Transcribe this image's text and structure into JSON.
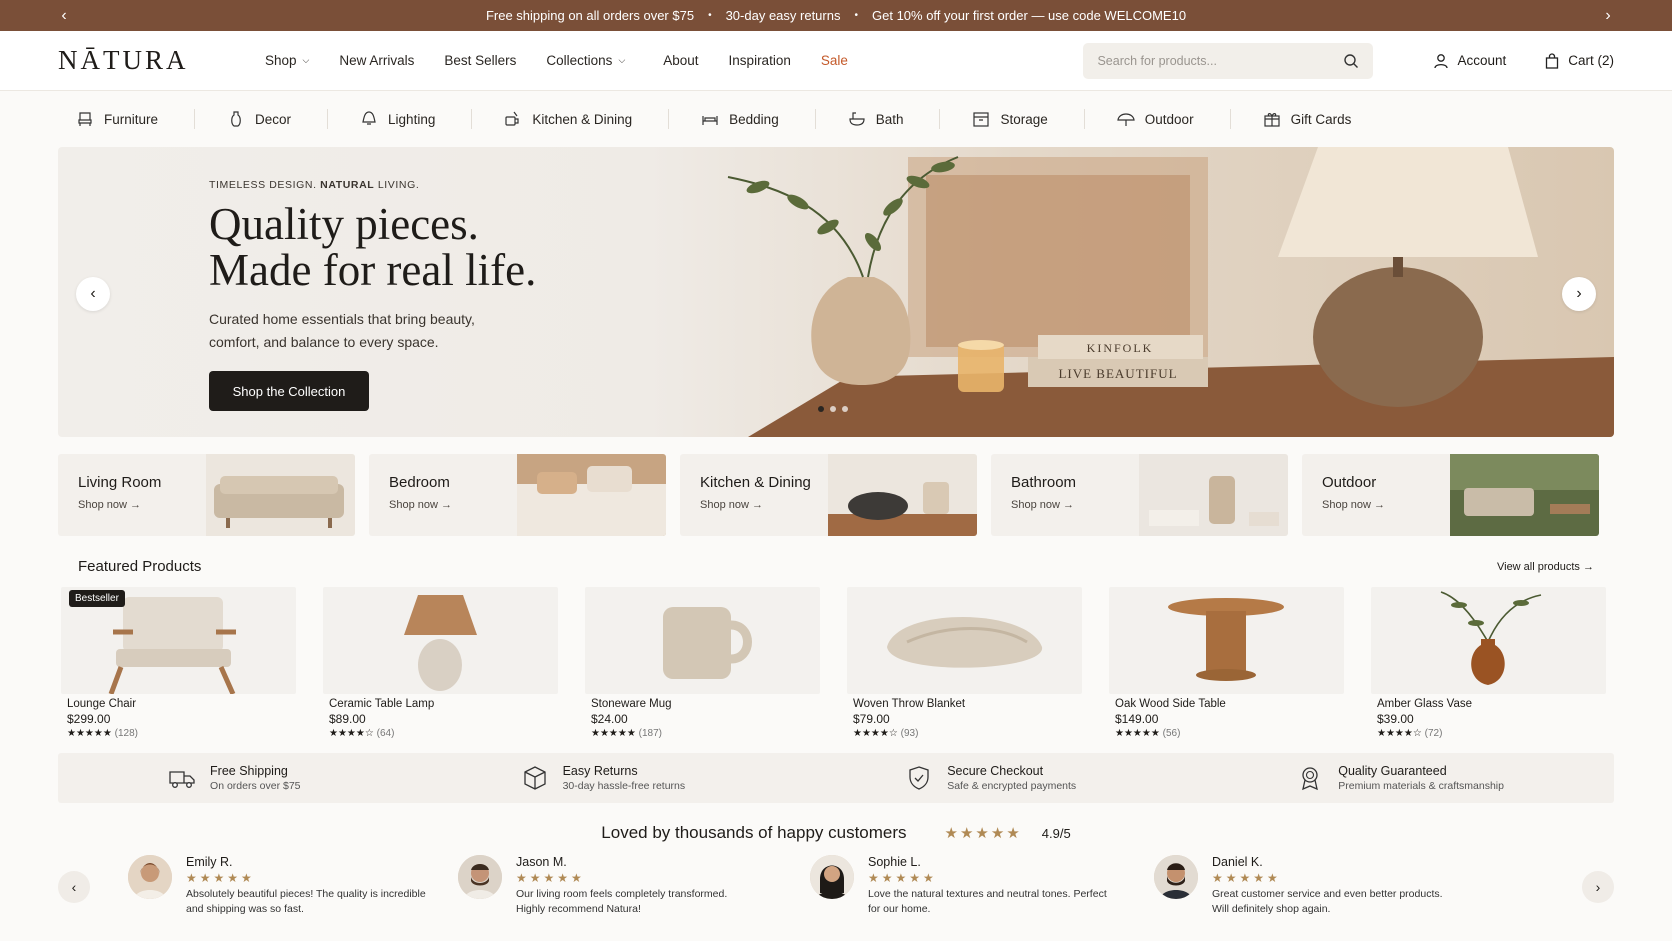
{
  "announcement": {
    "messages": [
      "Free shipping on all orders over $75",
      "30-day easy returns",
      "Get 10% off your first order — use code WELCOME10"
    ],
    "separator": "•",
    "prev": "‹",
    "next": "›"
  },
  "header": {
    "logo": "NĀTURA",
    "nav": [
      {
        "label": "Shop",
        "dropdown": true
      },
      {
        "label": "New Arrivals",
        "dropdown": false
      },
      {
        "label": "Best Sellers",
        "dropdown": false
      },
      {
        "label": "Collections",
        "dropdown": true
      },
      {
        "label": "About",
        "dropdown": false
      },
      {
        "label": "Inspiration",
        "dropdown": false
      },
      {
        "label": "Sale",
        "dropdown": false
      }
    ],
    "search_placeholder": "Search for products...",
    "account": "Account",
    "cart": "Cart (2)"
  },
  "categories": [
    {
      "label": "Furniture",
      "icon": "chair-icon"
    },
    {
      "label": "Decor",
      "icon": "vase-icon"
    },
    {
      "label": "Lighting",
      "icon": "lamp-icon"
    },
    {
      "label": "Kitchen & Dining",
      "icon": "kitchen-icon"
    },
    {
      "label": "Bedding",
      "icon": "bed-icon"
    },
    {
      "label": "Bath",
      "icon": "bath-icon"
    },
    {
      "label": "Storage",
      "icon": "storage-icon"
    },
    {
      "label": "Outdoor",
      "icon": "umbrella-icon"
    },
    {
      "label": "Gift Cards",
      "icon": "gift-icon"
    }
  ],
  "hero": {
    "tag_prefix": "TIMELESS DESIGN. ",
    "tag_bold": "NATURAL",
    "tag_suffix": " LIVING.",
    "title_line1": "Quality pieces.",
    "title_line2": "Made for real life.",
    "subtitle": "Curated home essentials that bring beauty, comfort, and balance to every space.",
    "cta": "Shop the Collection",
    "book1": "KINFOLK",
    "book2": "LIVE BEAUTIFUL",
    "active_slide": 1,
    "slide_count": 3
  },
  "rooms": [
    {
      "name": "Living Room",
      "link": "Shop now →"
    },
    {
      "name": "Bedroom",
      "link": "Shop now →"
    },
    {
      "name": "Kitchen & Dining",
      "link": "Shop now →"
    },
    {
      "name": "Bathroom",
      "link": "Shop now →"
    },
    {
      "name": "Outdoor",
      "link": "Shop now →"
    }
  ],
  "featured": {
    "title": "Featured Products",
    "view_all": "View all products →",
    "products": [
      {
        "name": "Lounge Chair",
        "price": "$299.00",
        "stars": "★★★★★",
        "count": "(128)",
        "badge": "Bestseller"
      },
      {
        "name": "Ceramic Table Lamp",
        "price": "$89.00",
        "stars": "★★★★☆",
        "count": "(64)",
        "badge": ""
      },
      {
        "name": "Stoneware Mug",
        "price": "$24.00",
        "stars": "★★★★★",
        "count": "(187)",
        "badge": ""
      },
      {
        "name": "Woven Throw Blanket",
        "price": "$79.00",
        "stars": "★★★★☆",
        "count": "(93)",
        "badge": ""
      },
      {
        "name": "Oak Wood Side Table",
        "price": "$149.00",
        "stars": "★★★★★",
        "count": "(56)",
        "badge": ""
      },
      {
        "name": "Amber Glass Vase",
        "price": "$39.00",
        "stars": "★★★★☆",
        "count": "(72)",
        "badge": ""
      }
    ]
  },
  "features": [
    {
      "title": "Free Shipping",
      "sub": "On orders over $75",
      "icon": "truck-icon"
    },
    {
      "title": "Easy Returns",
      "sub": "30-day hassle-free returns",
      "icon": "box-icon"
    },
    {
      "title": "Secure Checkout",
      "sub": "Safe & encrypted payments",
      "icon": "shield-icon"
    },
    {
      "title": "Quality Guaranteed",
      "sub": "Premium materials & craftsmanship",
      "icon": "award-icon"
    }
  ],
  "testimonials": {
    "title": "Loved by thousands of happy customers",
    "stars": "★★★★★",
    "score": "4.9/5",
    "reviews": [
      {
        "name": "Emily R.",
        "stars": "★★★★★",
        "text": "Absolutely beautiful pieces! The quality is incredible and shipping was so fast."
      },
      {
        "name": "Jason M.",
        "stars": "★★★★★",
        "text": "Our living room feels completely transformed. Highly recommend Natura!"
      },
      {
        "name": "Sophie L.",
        "stars": "★★★★★",
        "text": "Love the natural textures and neutral tones. Perfect for our home."
      },
      {
        "name": "Daniel K.",
        "stars": "★★★★★",
        "text": "Great customer service and even better products. Will definitely shop again."
      }
    ]
  },
  "colors": {
    "announcement_bg": "#7a4f38",
    "accent_sale": "#c45a2a",
    "star": "#b08a55",
    "dark": "#1f1c19"
  }
}
